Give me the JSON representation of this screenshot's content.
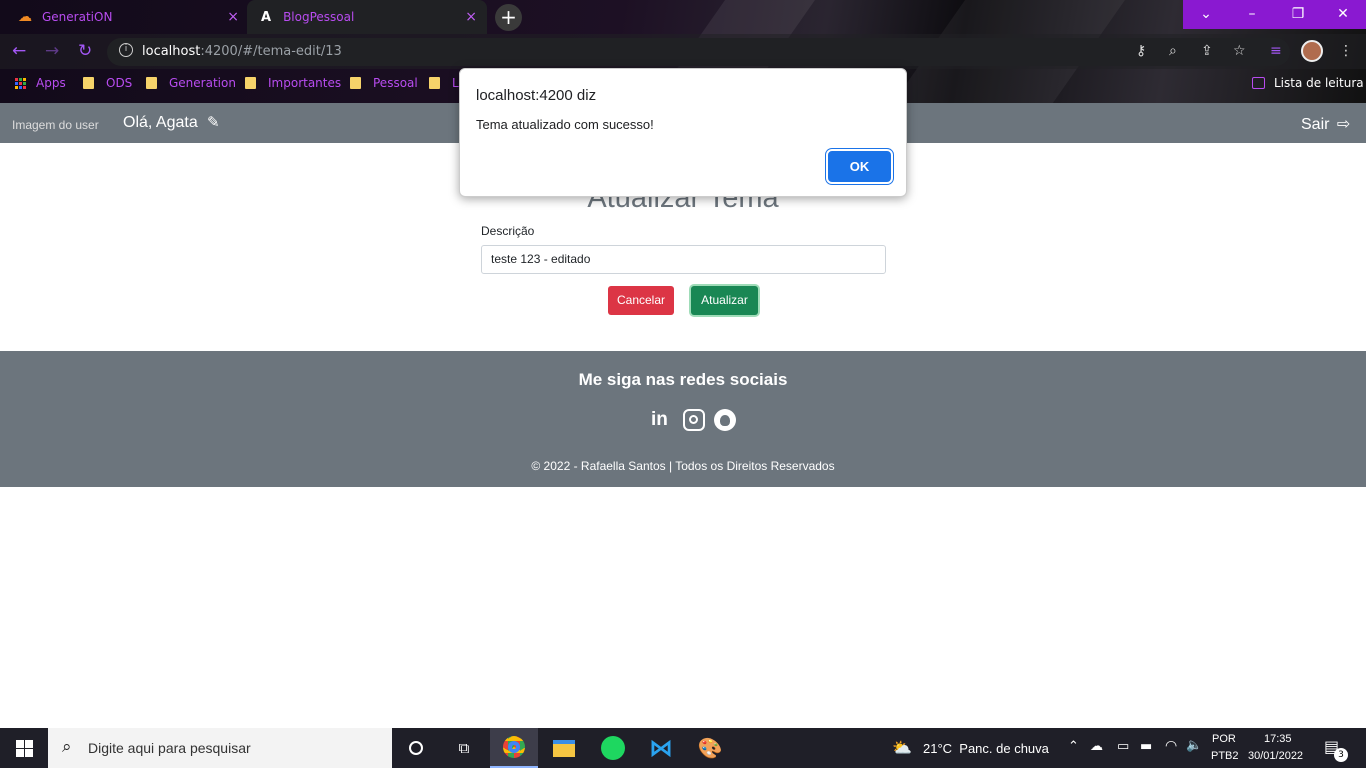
{
  "browser": {
    "tabs": [
      {
        "title": "GeneratiON",
        "close": "×"
      },
      {
        "title": "BlogPessoal",
        "close": "×"
      }
    ],
    "new_tab": "+",
    "url_host": "localhost",
    "url_path": ":4200/#/tema-edit/13",
    "bookmarks": [
      "Apps",
      "ODS",
      "Generation",
      "Importantes",
      "Pessoal",
      "L"
    ],
    "reading_list": "Lista de leitura",
    "window_controls": {
      "minimize": "–",
      "restore": "❐",
      "close": "✕",
      "dropdown": "⌄"
    }
  },
  "page": {
    "nav": {
      "avatar_alt": "Imagem do user",
      "greeting": "Olá, Agata",
      "logout": "Sair"
    },
    "title": "Atualizar Tema",
    "form": {
      "label": "Descrição",
      "value": "teste 123 - editado"
    },
    "buttons": {
      "cancel": "Cancelar",
      "update": "Atualizar"
    },
    "footer": {
      "heading": "Me siga nas redes sociais",
      "copyright": "© 2022 - Rafaella Santos | Todos os Direitos Reservados"
    }
  },
  "dialog": {
    "title": "localhost:4200 diz",
    "message": "Tema atualizado com sucesso!",
    "ok": "OK"
  },
  "taskbar": {
    "search_placeholder": "Digite aqui para pesquisar",
    "weather": "21°C  Panc. de chuva",
    "lang": "POR",
    "layout": "PTB2",
    "time": "17:35",
    "date": "30/01/2022",
    "notifications": "3"
  },
  "colors": {
    "accent": "#8a19d1",
    "nav_gray": "#6c757d",
    "danger": "#dc3545",
    "success": "#198754",
    "ok_blue": "#1a73e8"
  }
}
